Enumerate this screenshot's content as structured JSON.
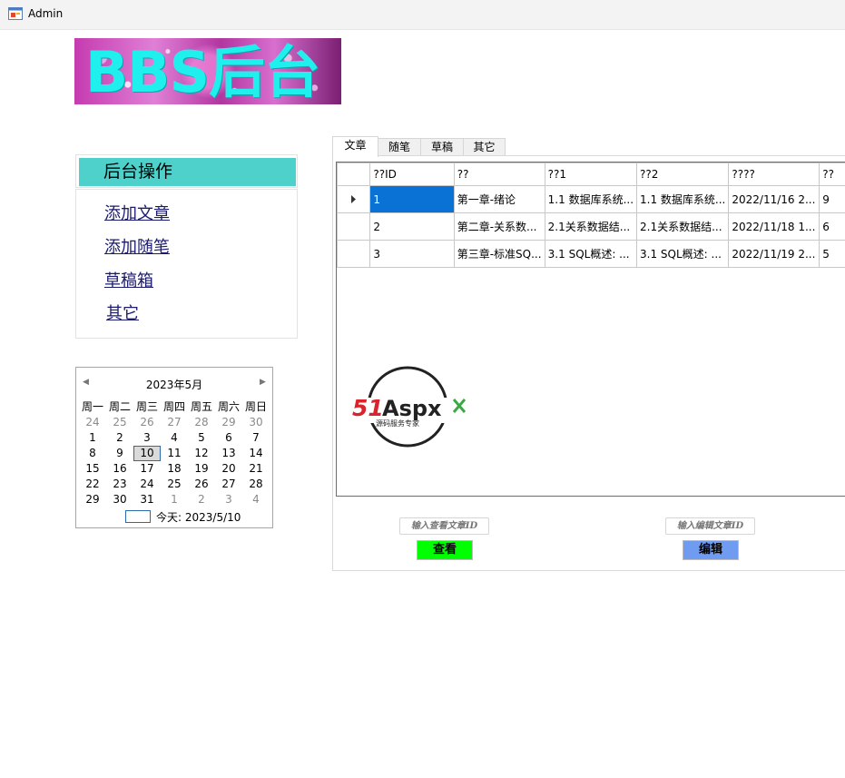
{
  "window": {
    "title": "Admin",
    "icon": "winforms-app-icon"
  },
  "banner": {
    "text": "BBS后台"
  },
  "sidebar": {
    "header": "后台操作",
    "links": [
      "添加文章",
      "添加随笔",
      "草稿箱",
      "其它"
    ]
  },
  "calendar": {
    "title": "2023年5月",
    "prev_icon": "triangle-left-icon",
    "next_icon": "triangle-right-icon",
    "weekdays": [
      "周一",
      "周二",
      "周三",
      "周四",
      "周五",
      "周六",
      "周日"
    ],
    "weeks": [
      [
        "24",
        "25",
        "26",
        "27",
        "28",
        "29",
        "30"
      ],
      [
        "1",
        "2",
        "3",
        "4",
        "5",
        "6",
        "7"
      ],
      [
        "8",
        "9",
        "10",
        "11",
        "12",
        "13",
        "14"
      ],
      [
        "15",
        "16",
        "17",
        "18",
        "19",
        "20",
        "21"
      ],
      [
        "22",
        "23",
        "24",
        "25",
        "26",
        "27",
        "28"
      ],
      [
        "29",
        "30",
        "31",
        "1",
        "2",
        "3",
        "4"
      ]
    ],
    "selected_day": "10",
    "today_label": "今天: 2023/5/10"
  },
  "tabs": [
    "文章",
    "随笔",
    "草稿",
    "其它"
  ],
  "active_tab": "文章",
  "grid": {
    "columns": [
      "??ID",
      "??",
      "??1",
      "??2",
      "????",
      "??"
    ],
    "rows": [
      [
        "1",
        "第一章-绪论",
        "1.1 数据库系统...",
        "1.1 数据库系统...",
        "2022/11/16 2...",
        "9"
      ],
      [
        "2",
        "第二章-关系数...",
        "2.1关系数据结...",
        "2.1关系数据结...",
        "2022/11/18 1...",
        "6"
      ],
      [
        "3",
        "第三章-标准SQ...",
        "3.1 SQL概述: ...",
        "3.1 SQL概述: ...",
        "2022/11/19 2...",
        "5"
      ]
    ],
    "current_row_icon": "row-pointer-icon"
  },
  "logo": {
    "text": "51Aspx",
    "subtitle": "源码服务专家"
  },
  "actions": {
    "view_placeholder": "输入查看文章ID",
    "view_button": "查看",
    "edit_placeholder": "输入编辑文章ID",
    "edit_button": "编辑",
    "view_button_color": "#00ff00",
    "edit_button_color": "#6f9cf0"
  }
}
